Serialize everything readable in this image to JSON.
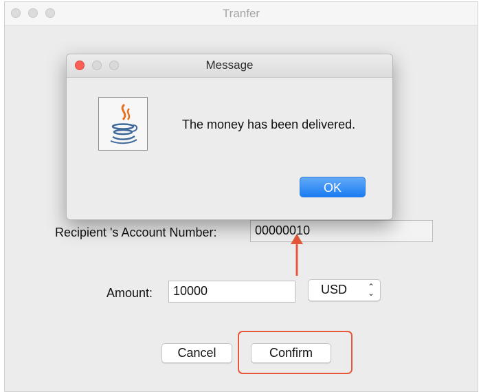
{
  "window": {
    "title": "Tranfer"
  },
  "form": {
    "recipient_label": "Recipient 's Account Number:",
    "recipient_value": "00000010",
    "amount_label": "Amount:",
    "amount_value": "10000",
    "currency_selected": "USD",
    "cancel_label": "Cancel",
    "confirm_label": "Confirm"
  },
  "dialog": {
    "title": "Message",
    "message": "The money has been delivered.",
    "ok_label": "OK",
    "icon": "java-icon"
  },
  "colors": {
    "annotation": "#e8573a",
    "ok_button": "#1a7cf2",
    "close_red": "#fc5f57"
  }
}
